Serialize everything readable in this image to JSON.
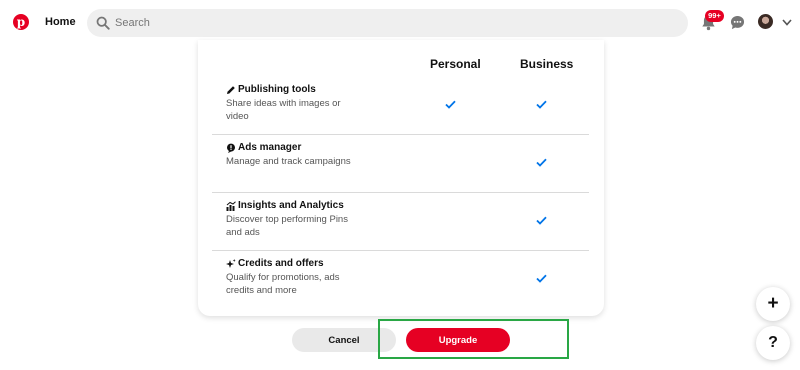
{
  "nav": {
    "home_label": "Home",
    "search_placeholder": "Search",
    "notification_badge": "99+",
    "icons": [
      "pinterest-logo",
      "search-icon",
      "bell-icon",
      "chat-icon",
      "avatar",
      "chevron-down-icon"
    ]
  },
  "plans": {
    "columns": [
      "Personal",
      "Business"
    ],
    "features": [
      {
        "title": "Publishing tools",
        "icon": "pencil-icon",
        "description": "Share ideas with images or video",
        "personal": true,
        "business": true
      },
      {
        "title": "Ads manager",
        "icon": "alert-icon",
        "description": "Manage and track campaigns",
        "personal": false,
        "business": true
      },
      {
        "title": "Insights and Analytics",
        "icon": "analytics-icon",
        "description": "Discover top performing Pins and ads",
        "personal": false,
        "business": true
      },
      {
        "title": "Credits and offers",
        "icon": "sparkle-icon",
        "description": "Qualify for promotions, ads credits and more",
        "personal": false,
        "business": true
      }
    ]
  },
  "actions": {
    "cancel_label": "Cancel",
    "upgrade_label": "Upgrade"
  },
  "floating": {
    "plus_label": "+",
    "help_label": "?"
  },
  "colors": {
    "brand": "#e60023",
    "check": "#0074e8",
    "highlight": "#29a745"
  }
}
